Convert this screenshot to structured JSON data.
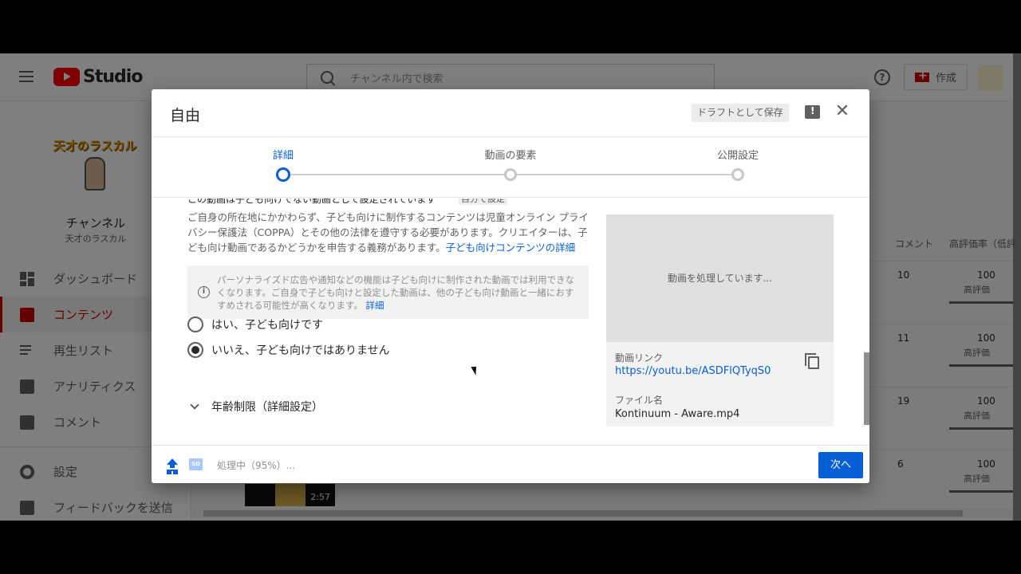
{
  "app": {
    "title": "Studio"
  },
  "search": {
    "placeholder": "チャンネル内で検索"
  },
  "header": {
    "create_label": "作成"
  },
  "channel": {
    "logo_text": "天才のラスカル",
    "label": "チャンネル",
    "name": "天才のラスカル"
  },
  "sidebar": {
    "items": [
      {
        "label": "ダッシュボード"
      },
      {
        "label": "コンテンツ"
      },
      {
        "label": "再生リスト"
      },
      {
        "label": "アナリティクス"
      },
      {
        "label": "コメント"
      },
      {
        "label": "設定"
      },
      {
        "label": "フィードバックを送信"
      }
    ]
  },
  "table": {
    "columns": {
      "comments": "コメント",
      "rating": "高評価率（低評"
    },
    "rows": [
      {
        "comments": "10",
        "rating": "100",
        "sub": "高評価"
      },
      {
        "comments": "11",
        "rating": "100",
        "sub": "高評価"
      },
      {
        "comments": "19",
        "rating": "100",
        "sub": "高評価"
      },
      {
        "comments": "6",
        "rating": "100",
        "sub": "高評価"
      }
    ],
    "thumb_duration": "2:57"
  },
  "dialog": {
    "title": "自由",
    "draft_label": "ドラフトとして保存",
    "steps": [
      {
        "label": "詳細"
      },
      {
        "label": "動画の要素"
      },
      {
        "label": "公開設定"
      }
    ],
    "cut_text": "この動画は子ども向けでない動画として設定されています",
    "cut_badge": "自分で設定",
    "paragraph": "ご自身の所在地にかかわらず、子ども向けに制作するコンテンツは児童オンライン プライバシー保護法（COPPA）とその他の法律を遵守する必要があります。クリエイターは、子ども向け動画であるかどうかを申告する義務があります。",
    "paragraph_link": "子ども向けコンテンツの詳細",
    "info_text": "パーソナライズド広告や通知などの機能は子ども向けに制作された動画では利用できなくなります。ご自身で子ども向けと設定した動画は、他の子ども向け動画と一緒におすすめされる可能性が高くなります。",
    "info_link": "詳細",
    "radio_yes": "はい、子ども向けです",
    "radio_no": "いいえ、子ども向けではありません",
    "selected": "no",
    "age_label": "年齢制限（詳細設定）",
    "preview": {
      "processing": "動画を処理しています...",
      "link_label": "動画リンク",
      "link": "https://youtu.be/ASDFlQTyqS0",
      "file_label": "ファイル名",
      "file": "Kontinuum - Aware.mp4"
    },
    "footer": {
      "status": "処理中（95%）...",
      "progress_percent": 95,
      "sd_label": "SD",
      "next_label": "次へ"
    }
  },
  "colors": {
    "accent": "#065fd4",
    "brand": "#ff0000",
    "active_nav": "#cc0000"
  }
}
